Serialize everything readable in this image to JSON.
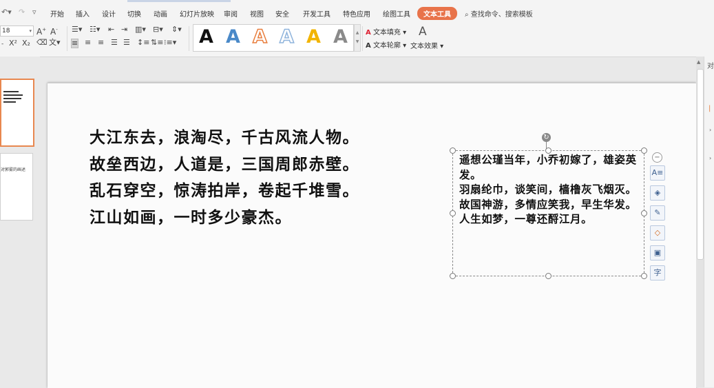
{
  "tabs": [
    "开始",
    "插入",
    "设计",
    "切换",
    "动画",
    "幻灯片放映",
    "审阅",
    "视图",
    "安全",
    "开发工具",
    "特色应用",
    "绘图工具",
    "文本工具"
  ],
  "active_tab": "文本工具",
  "search_placeholder": "查找命令、搜索模板",
  "font_size": "18",
  "text_fill_label": "文本填充",
  "text_outline_label": "文本轮廓",
  "text_effect_label": "文本效果",
  "wordart_glyph": "A",
  "slide2_label": "对郭雾的画述",
  "right_panel_char": "对",
  "poem_left": [
    "大江东去，浪淘尽，千古风流人物。",
    "故垒西边，人道是，三国周郎赤壁。",
    "乱石穿空，惊涛拍岸，卷起千堆雪。",
    "江山如画，一时多少豪杰。"
  ],
  "poem_right_lines": [
    "遥想公瑾当年，小乔初嫁了，雄姿英发。",
    "羽扇纶巾，谈笑间，樯橹灰飞烟灭。",
    "故国神游，多情应笑我，早生华发。",
    "人生如梦，一尊还酹江月。"
  ],
  "float_toolbar_glyph": "字",
  "colors": {
    "active_tab_bg": "#e8734a",
    "selected_thumb_border": "#e8874f",
    "wordart": [
      "#111111",
      "#4a89c8",
      "#e87d3c",
      "#8fb4dc",
      "#f2b400",
      "#8a8a8a"
    ]
  }
}
